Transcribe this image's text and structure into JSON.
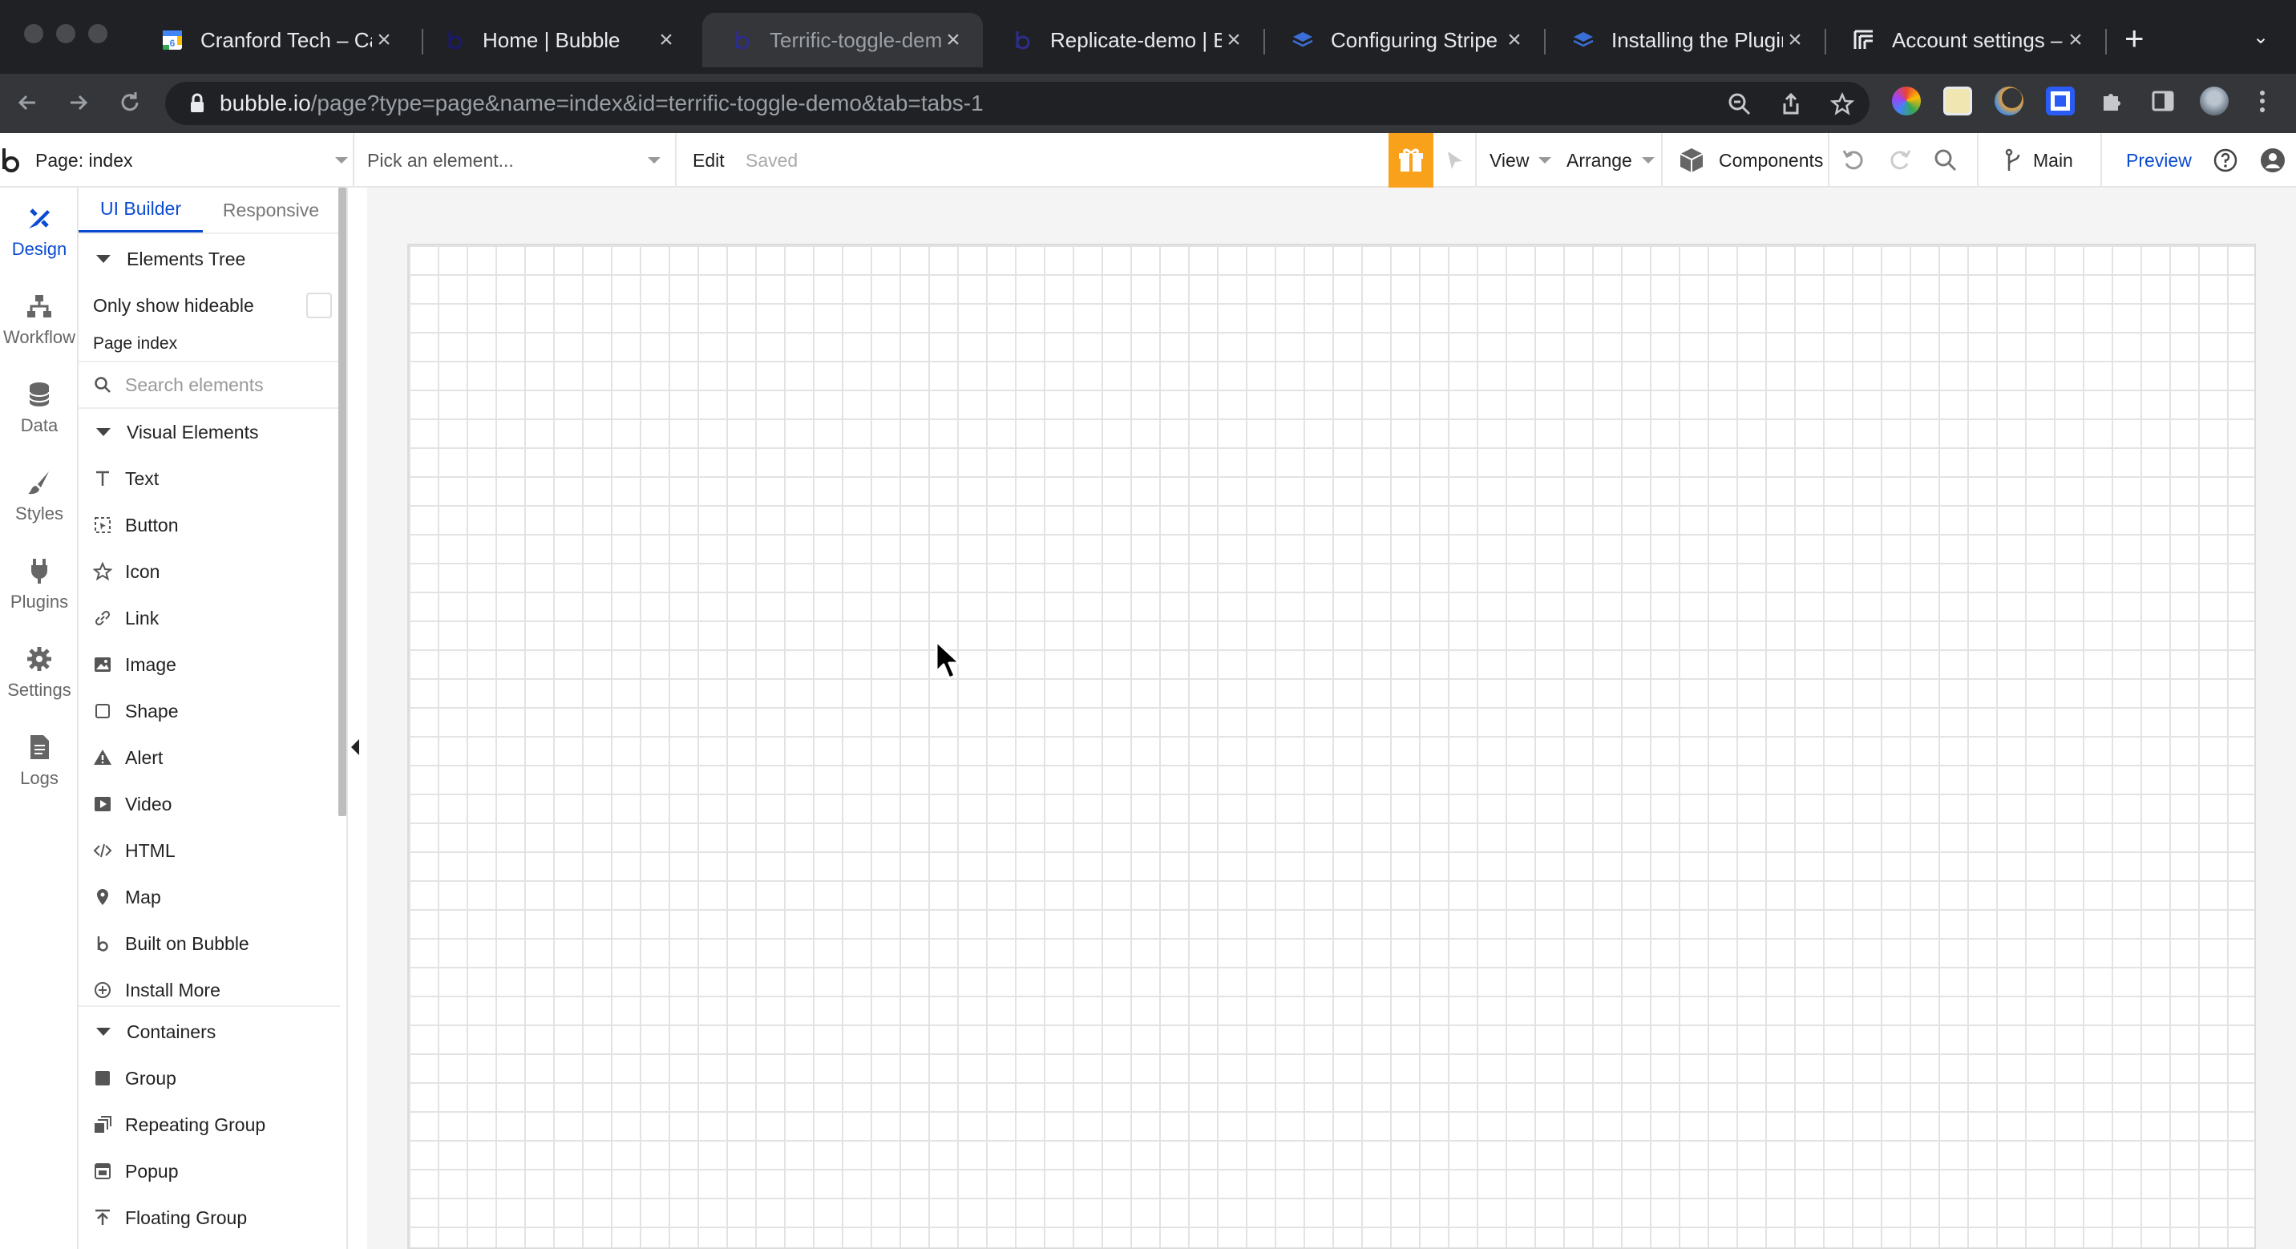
{
  "browser": {
    "tabs": [
      {
        "title": "Cranford Tech – Ca",
        "favicon": "google-calendar-icon"
      },
      {
        "title": "Home | Bubble",
        "favicon": "bubble-icon"
      },
      {
        "title": "Terrific-toggle-dem",
        "favicon": "bubble-icon",
        "active": true
      },
      {
        "title": "Replicate-demo | Bu",
        "favicon": "bubble-icon"
      },
      {
        "title": "Configuring Stripe /",
        "favicon": "stack-icon"
      },
      {
        "title": "Installing the Plugin",
        "favicon": "stack-icon"
      },
      {
        "title": "Account settings –",
        "favicon": "settings-doc-icon"
      }
    ],
    "url_host": "bubble.io",
    "url_path": "/page?type=page&name=index&id=terrific-toggle-demo&tab=tabs-1"
  },
  "editor": {
    "page_select": "Page: index",
    "element_picker": "Pick an element...",
    "edit_label": "Edit",
    "saved_status": "Saved",
    "view_label": "View",
    "arrange_label": "Arrange",
    "components_label": "Components",
    "branch_label": "Main",
    "preview_label": "Preview",
    "accent_color": "#0b4bd1",
    "gift_color": "#f9a11b"
  },
  "rail": {
    "items": [
      {
        "label": "Design",
        "icon": "design-icon"
      },
      {
        "label": "Workflow",
        "icon": "workflow-icon"
      },
      {
        "label": "Data",
        "icon": "database-icon"
      },
      {
        "label": "Styles",
        "icon": "brush-icon"
      },
      {
        "label": "Plugins",
        "icon": "plug-icon"
      },
      {
        "label": "Settings",
        "icon": "gear-icon"
      },
      {
        "label": "Logs",
        "icon": "log-icon"
      }
    ]
  },
  "panel": {
    "tabs": [
      "UI Builder",
      "Responsive"
    ],
    "elements_tree": "Elements Tree",
    "only_show_hideable": "Only show hideable",
    "page_name": "Page index",
    "search_placeholder": "Search elements",
    "visual_elements_header": "Visual Elements",
    "visual_elements": [
      "Text",
      "Button",
      "Icon",
      "Link",
      "Image",
      "Shape",
      "Alert",
      "Video",
      "HTML",
      "Map",
      "Built on Bubble",
      "Install More"
    ],
    "containers_header": "Containers",
    "containers": [
      "Group",
      "Repeating Group",
      "Popup",
      "Floating Group"
    ]
  }
}
